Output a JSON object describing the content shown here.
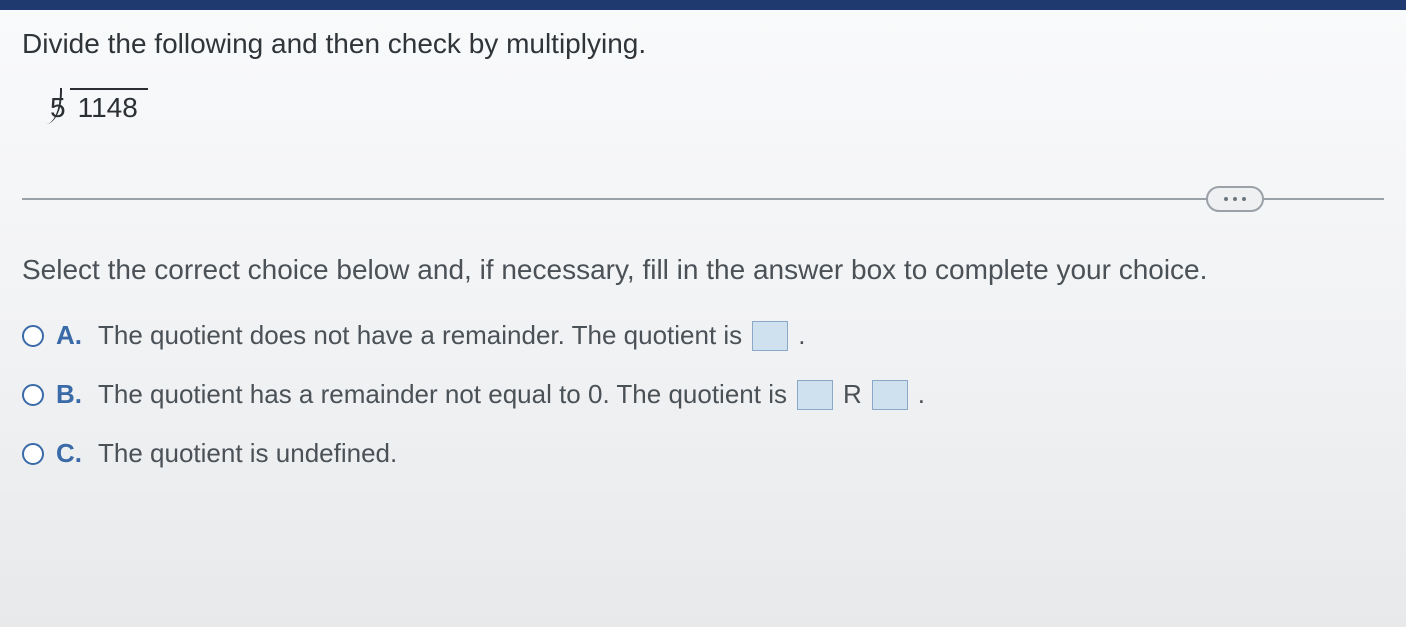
{
  "question": {
    "prompt": "Divide the following and then check by multiplying.",
    "divisor": "5",
    "dividend": "1148"
  },
  "instruction": "Select the correct choice below and, if necessary, fill in the answer box to complete your choice.",
  "choices": {
    "a": {
      "letter": "A.",
      "text_before": "The quotient does not have a remainder. The quotient is",
      "box_value": "",
      "text_after": "."
    },
    "b": {
      "letter": "B.",
      "text_before": "The quotient has a remainder not equal to 0. The quotient is",
      "box1_value": "",
      "r_label": "R",
      "box2_value": "",
      "text_after": "."
    },
    "c": {
      "letter": "C.",
      "text": "The quotient is undefined."
    }
  }
}
